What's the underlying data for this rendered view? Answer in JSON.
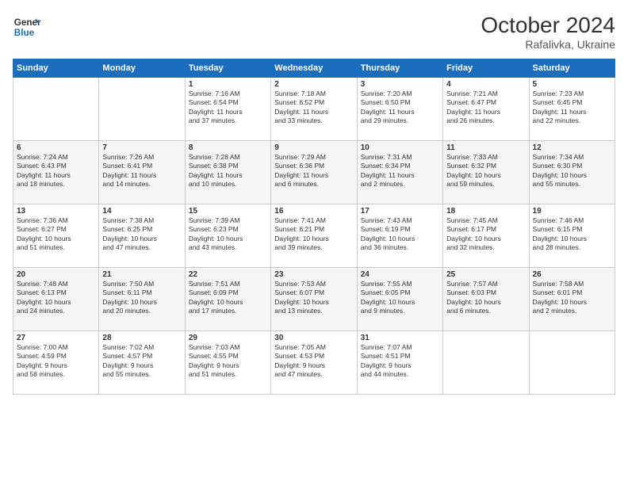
{
  "header": {
    "logo_general": "General",
    "logo_blue": "Blue",
    "month_year": "October 2024",
    "location": "Rafalivka, Ukraine"
  },
  "weekdays": [
    "Sunday",
    "Monday",
    "Tuesday",
    "Wednesday",
    "Thursday",
    "Friday",
    "Saturday"
  ],
  "weeks": [
    [
      {
        "day": "",
        "info": ""
      },
      {
        "day": "",
        "info": ""
      },
      {
        "day": "1",
        "info": "Sunrise: 7:16 AM\nSunset: 6:54 PM\nDaylight: 11 hours\nand 37 minutes."
      },
      {
        "day": "2",
        "info": "Sunrise: 7:18 AM\nSunset: 6:52 PM\nDaylight: 11 hours\nand 33 minutes."
      },
      {
        "day": "3",
        "info": "Sunrise: 7:20 AM\nSunset: 6:50 PM\nDaylight: 11 hours\nand 29 minutes."
      },
      {
        "day": "4",
        "info": "Sunrise: 7:21 AM\nSunset: 6:47 PM\nDaylight: 11 hours\nand 26 minutes."
      },
      {
        "day": "5",
        "info": "Sunrise: 7:23 AM\nSunset: 6:45 PM\nDaylight: 11 hours\nand 22 minutes."
      }
    ],
    [
      {
        "day": "6",
        "info": "Sunrise: 7:24 AM\nSunset: 6:43 PM\nDaylight: 11 hours\nand 18 minutes."
      },
      {
        "day": "7",
        "info": "Sunrise: 7:26 AM\nSunset: 6:41 PM\nDaylight: 11 hours\nand 14 minutes."
      },
      {
        "day": "8",
        "info": "Sunrise: 7:28 AM\nSunset: 6:38 PM\nDaylight: 11 hours\nand 10 minutes."
      },
      {
        "day": "9",
        "info": "Sunrise: 7:29 AM\nSunset: 6:36 PM\nDaylight: 11 hours\nand 6 minutes."
      },
      {
        "day": "10",
        "info": "Sunrise: 7:31 AM\nSunset: 6:34 PM\nDaylight: 11 hours\nand 2 minutes."
      },
      {
        "day": "11",
        "info": "Sunrise: 7:33 AM\nSunset: 6:32 PM\nDaylight: 10 hours\nand 59 minutes."
      },
      {
        "day": "12",
        "info": "Sunrise: 7:34 AM\nSunset: 6:30 PM\nDaylight: 10 hours\nand 55 minutes."
      }
    ],
    [
      {
        "day": "13",
        "info": "Sunrise: 7:36 AM\nSunset: 6:27 PM\nDaylight: 10 hours\nand 51 minutes."
      },
      {
        "day": "14",
        "info": "Sunrise: 7:38 AM\nSunset: 6:25 PM\nDaylight: 10 hours\nand 47 minutes."
      },
      {
        "day": "15",
        "info": "Sunrise: 7:39 AM\nSunset: 6:23 PM\nDaylight: 10 hours\nand 43 minutes."
      },
      {
        "day": "16",
        "info": "Sunrise: 7:41 AM\nSunset: 6:21 PM\nDaylight: 10 hours\nand 39 minutes."
      },
      {
        "day": "17",
        "info": "Sunrise: 7:43 AM\nSunset: 6:19 PM\nDaylight: 10 hours\nand 36 minutes."
      },
      {
        "day": "18",
        "info": "Sunrise: 7:45 AM\nSunset: 6:17 PM\nDaylight: 10 hours\nand 32 minutes."
      },
      {
        "day": "19",
        "info": "Sunrise: 7:46 AM\nSunset: 6:15 PM\nDaylight: 10 hours\nand 28 minutes."
      }
    ],
    [
      {
        "day": "20",
        "info": "Sunrise: 7:48 AM\nSunset: 6:13 PM\nDaylight: 10 hours\nand 24 minutes."
      },
      {
        "day": "21",
        "info": "Sunrise: 7:50 AM\nSunset: 6:11 PM\nDaylight: 10 hours\nand 20 minutes."
      },
      {
        "day": "22",
        "info": "Sunrise: 7:51 AM\nSunset: 6:09 PM\nDaylight: 10 hours\nand 17 minutes."
      },
      {
        "day": "23",
        "info": "Sunrise: 7:53 AM\nSunset: 6:07 PM\nDaylight: 10 hours\nand 13 minutes."
      },
      {
        "day": "24",
        "info": "Sunrise: 7:55 AM\nSunset: 6:05 PM\nDaylight: 10 hours\nand 9 minutes."
      },
      {
        "day": "25",
        "info": "Sunrise: 7:57 AM\nSunset: 6:03 PM\nDaylight: 10 hours\nand 6 minutes."
      },
      {
        "day": "26",
        "info": "Sunrise: 7:58 AM\nSunset: 6:01 PM\nDaylight: 10 hours\nand 2 minutes."
      }
    ],
    [
      {
        "day": "27",
        "info": "Sunrise: 7:00 AM\nSunset: 4:59 PM\nDaylight: 9 hours\nand 58 minutes."
      },
      {
        "day": "28",
        "info": "Sunrise: 7:02 AM\nSunset: 4:57 PM\nDaylight: 9 hours\nand 55 minutes."
      },
      {
        "day": "29",
        "info": "Sunrise: 7:03 AM\nSunset: 4:55 PM\nDaylight: 9 hours\nand 51 minutes."
      },
      {
        "day": "30",
        "info": "Sunrise: 7:05 AM\nSunset: 4:53 PM\nDaylight: 9 hours\nand 47 minutes."
      },
      {
        "day": "31",
        "info": "Sunrise: 7:07 AM\nSunset: 4:51 PM\nDaylight: 9 hours\nand 44 minutes."
      },
      {
        "day": "",
        "info": ""
      },
      {
        "day": "",
        "info": ""
      }
    ]
  ]
}
